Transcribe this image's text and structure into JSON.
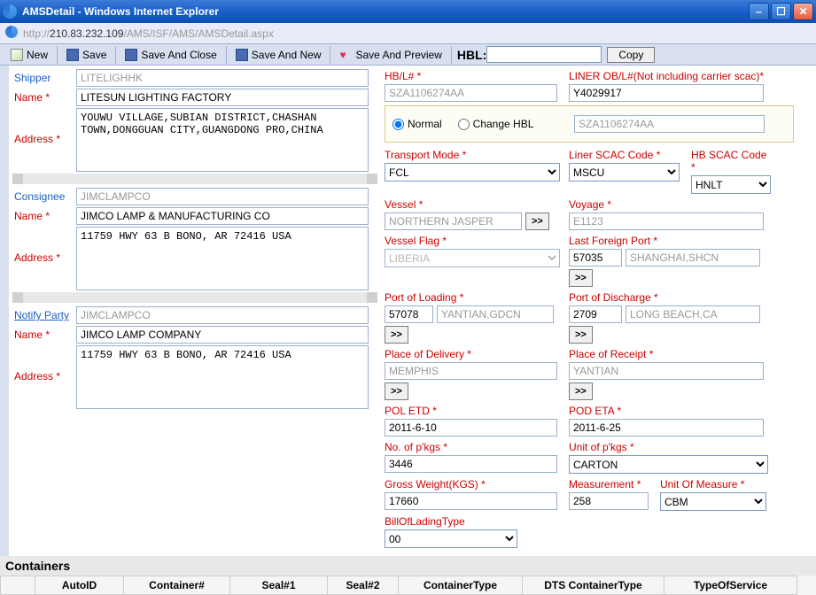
{
  "window": {
    "title": "AMSDetail - Windows Internet Explorer",
    "url_prefix": "http://",
    "url_host": "210.83.232.109",
    "url_path": "/AMS/ISF/AMS/AMSDetail.aspx"
  },
  "toolbar": {
    "new": "New",
    "save": "Save",
    "save_close": "Save And Close",
    "save_new": "Save And New",
    "save_preview": "Save And Preview",
    "hbl_label": "HBL:",
    "copy": "Copy"
  },
  "shipper": {
    "header": "Shipper",
    "code": "LITELIGHHK",
    "name_label": "Name *",
    "name": "LITESUN LIGHTING FACTORY",
    "address_label": "Address *",
    "address": "YOUWU VILLAGE,SUBIAN DISTRICT,CHASHAN TOWN,DONGGUAN CITY,GUANGDONG PRO,CHINA"
  },
  "consignee": {
    "header": "Consignee",
    "code": "JIMCLAMPCO",
    "name_label": "Name *",
    "name": "JIMCO LAMP & MANUFACTURING CO",
    "address_label": "Address *",
    "address": "11759 HWY 63 B BONO, AR 72416 USA"
  },
  "notify": {
    "header": "Notify Party",
    "code": "JIMCLAMPCO",
    "name_label": "Name *",
    "name": "JIMCO LAMP COMPANY",
    "address_label": "Address *",
    "address": "11759 HWY 63 B BONO, AR 72416 USA"
  },
  "right": {
    "hbl_label": "HB/L# *",
    "hbl": "SZA1106274AA",
    "liner_obl_label": "LINER OB/L#(Not including carrier scac)*",
    "liner_obl": "Y4029917",
    "radio_normal": "Normal",
    "radio_change": "Change HBL",
    "hbl2": "SZA1106274AA",
    "transport_mode_label": "Transport Mode *",
    "transport_mode": "FCL",
    "liner_scac_label": "Liner SCAC Code *",
    "liner_scac": "MSCU",
    "hb_scac_label": "HB SCAC Code *",
    "hb_scac": "HNLT",
    "vessel_label": "Vessel *",
    "vessel": "NORTHERN JASPER",
    "voyage_label": "Voyage *",
    "voyage": "E1123",
    "vessel_flag_label": "Vessel Flag *",
    "vessel_flag": "LIBERIA",
    "last_foreign_port_label": "Last Foreign Port *",
    "last_foreign_port_code": "57035",
    "last_foreign_port_name": "SHANGHAI,SHCN",
    "port_loading_label": "Port of Loading *",
    "port_loading_code": "57078",
    "port_loading_name": "YANTIAN,GDCN",
    "port_discharge_label": "Port of Discharge *",
    "port_discharge_code": "2709",
    "port_discharge_name": "LONG BEACH,CA",
    "place_delivery_label": "Place of Delivery *",
    "place_delivery": "MEMPHIS",
    "place_receipt_label": "Place of Receipt *",
    "place_receipt": "YANTIAN",
    "pol_etd_label": "POL ETD *",
    "pol_etd": "2011-6-10",
    "pod_eta_label": "POD ETA *",
    "pod_eta": "2011-6-25",
    "no_pkgs_label": "No. of p'kgs *",
    "no_pkgs": "3446",
    "unit_pkgs_label": "Unit of p'kgs *",
    "unit_pkgs": "CARTON",
    "gross_weight_label": "Gross Weight(KGS) *",
    "gross_weight": "17660",
    "measurement_label": "Measurement *",
    "measurement": "258",
    "uom_label": "Unit Of Measure *",
    "uom": "CBM",
    "bol_type_label": "BillOfLadingType",
    "bol_type": "00"
  },
  "containers": {
    "header": "Containers",
    "cols": {
      "autoid": "AutoID",
      "container": "Container#",
      "seal1": "Seal#1",
      "seal2": "Seal#2",
      "ctype": "ContainerType",
      "dts": "DTS ContainerType",
      "tos": "TypeOfService"
    }
  }
}
